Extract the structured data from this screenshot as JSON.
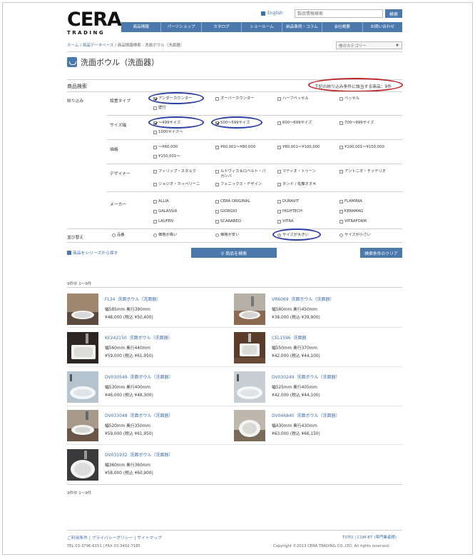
{
  "header": {
    "logo_main": "CERA",
    "logo_sub": "TRADING",
    "lang_label": "English",
    "search_placeholder": "製品情報検索",
    "search_button": "検索"
  },
  "nav": [
    "商品情報",
    "パーツショップ",
    "カタログ",
    "ショールーム",
    "納品事例・コラム",
    "会社概要",
    "お問い合わせ"
  ],
  "breadcrumb": {
    "home": "ホーム",
    "sep1": " / ",
    "db": "商品データベース",
    "sep2": " / ",
    "search": "商品情報検索",
    "sep3": " : ",
    "current": "洗面ボウル（洗面器）"
  },
  "category_select": "他のカテゴリー",
  "page_title": "洗面ボウル（洗面器）",
  "search": {
    "section_title": "商品検索",
    "count_note": "下記の絞り込み条件に該当する商品：9件",
    "filter_label": "絞り込み",
    "groups": {
      "type": {
        "label": "設置タイプ",
        "options": [
          {
            "label": "アンダーカウンター",
            "checked": true
          },
          {
            "label": "オーバーカウンター",
            "checked": false
          },
          {
            "label": "ハーフベッセル",
            "checked": false
          },
          {
            "label": "ベッセル",
            "checked": false
          },
          {
            "label": "壁付",
            "checked": false
          }
        ]
      },
      "width": {
        "label": "サイズ幅",
        "options": [
          {
            "label": "～499サイズ",
            "checked": true
          },
          {
            "label": "500～599サイズ",
            "checked": true
          },
          {
            "label": "600～699サイズ",
            "checked": false
          },
          {
            "label": "700～999サイズ",
            "checked": false
          },
          {
            "label": "1000サイズ～",
            "checked": false
          }
        ]
      },
      "price": {
        "label": "価格",
        "options": [
          {
            "label": "～¥60,000",
            "checked": false
          },
          {
            "label": "¥60,001～¥80,000",
            "checked": false
          },
          {
            "label": "¥80,001～¥100,000",
            "checked": false
          },
          {
            "label": "¥100,001～¥150,000",
            "checked": false
          },
          {
            "label": "¥150,001～",
            "checked": false
          }
        ]
      },
      "designer": {
        "label": "デザイナー",
        "options": [
          {
            "label": "フィリップ・スタルク",
            "checked": false
          },
          {
            "label": "ルドヴィカ＆ロベルト・パ\nガンパ",
            "checked": false
          },
          {
            "label": "マティオ・トゥーン",
            "checked": false
          },
          {
            "label": "アントニオ・チッテリオ",
            "checked": false
          },
          {
            "label": "ジョジオ・カッペリーニ",
            "checked": false
          },
          {
            "label": "フェニックス・デザイン",
            "checked": false
          },
          {
            "label": "ネンド / 佐藤オオキ",
            "checked": false
          }
        ]
      },
      "maker": {
        "label": "メーカー",
        "options": [
          {
            "label": "ALLIA",
            "checked": false
          },
          {
            "label": "CERA ORIGINAL",
            "checked": false
          },
          {
            "label": "DURAVIT",
            "checked": false
          },
          {
            "label": "FLAMINIA",
            "checked": false
          },
          {
            "label": "GALASSIA",
            "checked": false
          },
          {
            "label": "GIORGIO",
            "checked": false
          },
          {
            "label": "HIGHTECH",
            "checked": false
          },
          {
            "label": "KERAMAG",
            "checked": false
          },
          {
            "label": "LAUFEN",
            "checked": false
          },
          {
            "label": "SCARABEO",
            "checked": false
          },
          {
            "label": "VITRA",
            "checked": false
          },
          {
            "label": "VITRAFORM",
            "checked": false
          }
        ]
      }
    },
    "sort": {
      "label": "並び替え",
      "options": [
        {
          "label": "品番",
          "checked": false
        },
        {
          "label": "価格が高い",
          "checked": false
        },
        {
          "label": "価格が安い",
          "checked": false
        },
        {
          "label": "サイズが大きい",
          "checked": true
        },
        {
          "label": "サイズが小さい",
          "checked": false
        }
      ]
    },
    "series_link": "商品をシリーズから探す",
    "search_button": "商品を検索",
    "clear_button": "検索条件のクリア"
  },
  "results": {
    "count_top": "9件中 1～9件",
    "count_bottom": "9件中 1～9件",
    "items": [
      {
        "code": "FL34",
        "name": "洗面ボウル（洗面器）",
        "size": "幅585mm 奥行390mm",
        "price": "¥48,000 (税込 ¥50,400)"
      },
      {
        "code": "VR6069",
        "name": "洗面ボウル（洗面器）",
        "size": "幅580mm 奥行450mm",
        "price": "¥38,000 (税込 ¥39,900)"
      },
      {
        "code": "KE242150",
        "name": "洗面ボウル（洗面器）",
        "size": "幅560mm 奥行440mm",
        "price": "¥59,000 (税込 ¥61,950)"
      },
      {
        "code": "CEL1596",
        "name": "洗面器",
        "size": "幅550mm 奥行370mm",
        "price": "¥42,000 (税込 ¥44,100)"
      },
      {
        "code": "DV030549",
        "name": "洗面ボウル（洗面器）",
        "size": "幅530mm 奥行400mm",
        "price": "¥46,000 (税込 ¥48,300)"
      },
      {
        "code": "DV030249",
        "name": "洗面ボウル（洗面器）",
        "size": "幅525mm 奥行405mm",
        "price": "¥42,000 (税込 ¥44,100)"
      },
      {
        "code": "DV033048",
        "name": "洗面ボウル（洗面器）",
        "size": "幅520mm 奥行350mm",
        "price": "¥59,000 (税込 ¥61,950)"
      },
      {
        "code": "DV046840",
        "name": "洗面ボウル（洗面器）",
        "size": "幅430mm 奥行430mm",
        "price": "¥63,000 (税込 ¥66,150)"
      },
      {
        "code": "DV031932",
        "name": "洗面ボウル（洗面器）",
        "size": "幅360mm 奥行360mm",
        "price": "¥58,000 (税込 ¥60,900)"
      }
    ]
  },
  "footer": {
    "links": "ご利用条件 | プライバシーポリシー | サイトマップ",
    "tel": "TEL 03-3796-6151 | FAX 03-3402-7185",
    "right_links": "TOTO | COM-ET (専門業者様)",
    "copyright": "Copyright ©2013 CERA TRADING CO.,LTD. All rights reserved."
  },
  "colors": {
    "accent": "#4b79ad",
    "link": "#3f6fa8",
    "highlight_blue": "#2b3fa5",
    "highlight_red": "#c0272d"
  }
}
